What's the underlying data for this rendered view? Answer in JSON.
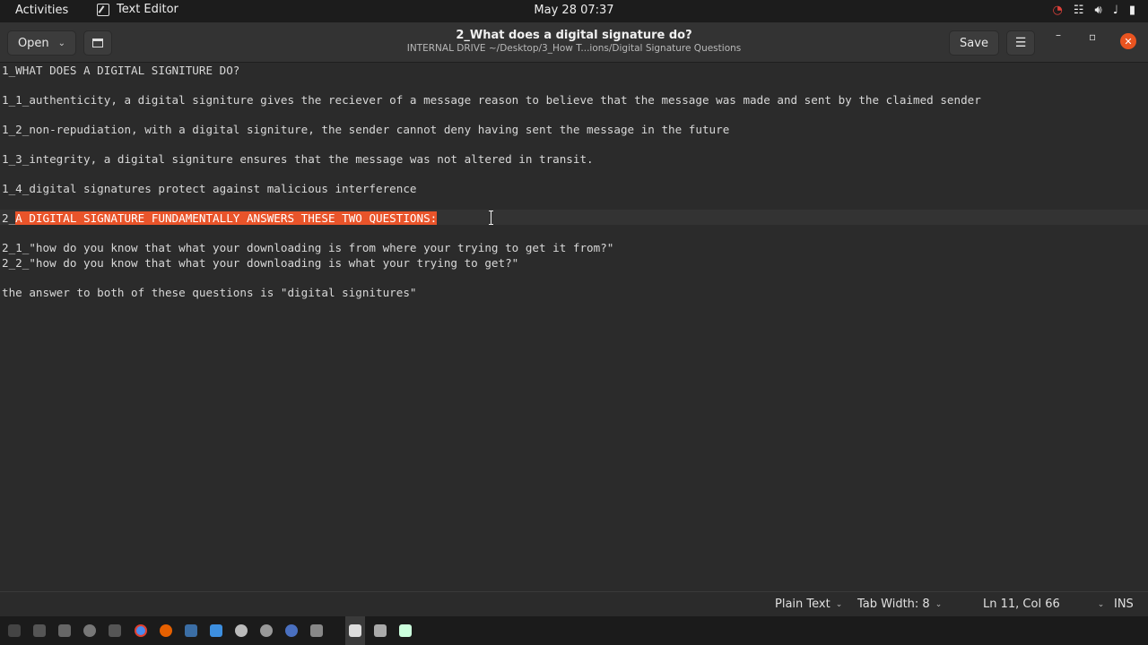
{
  "topbar": {
    "activities": "Activities",
    "app_name": "Text Editor",
    "clock": "May 28  07:37"
  },
  "header": {
    "open_label": "Open",
    "title": "2_What does a digital signature do?",
    "subtitle": "INTERNAL DRIVE ~/Desktop/3_How T...ions/Digital Signature Questions",
    "save_label": "Save"
  },
  "editor": {
    "lines": [
      {
        "text": "1_WHAT DOES A DIGITAL SIGNITURE DO?"
      },
      {
        "text": "1_1_authenticity, a digital signiture gives the reciever of a message reason to believe that the message was made and sent by the claimed sender"
      },
      {
        "text": "1_2_non-repudiation, with a digital signiture, the sender cannot deny having sent the message in the future"
      },
      {
        "text": "1_3_integrity, a digital signiture ensures that the message was not altered in transit."
      },
      {
        "text": "1_4_digital signatures protect against malicious interference"
      },
      {
        "prefix": "2_",
        "selected": "A DIGITAL SIGNATURE FUNDAMENTALLY ANSWERS THESE TWO QUESTIONS:"
      },
      {
        "text": "2_1_\"how do you know that what your downloading is from where your trying to get it from?\""
      },
      {
        "text": "2_2_\"how do you know that what your downloading is what your trying to get?\""
      },
      {
        "text": "the answer to both of these questions is \"digital signitures\""
      }
    ]
  },
  "statusbar": {
    "language": "Plain Text",
    "tab_width": "Tab Width: 8",
    "position": "Ln 11, Col 66",
    "mode": "INS"
  },
  "colors": {
    "selection": "#e9542a",
    "close_button": "#e95420"
  }
}
